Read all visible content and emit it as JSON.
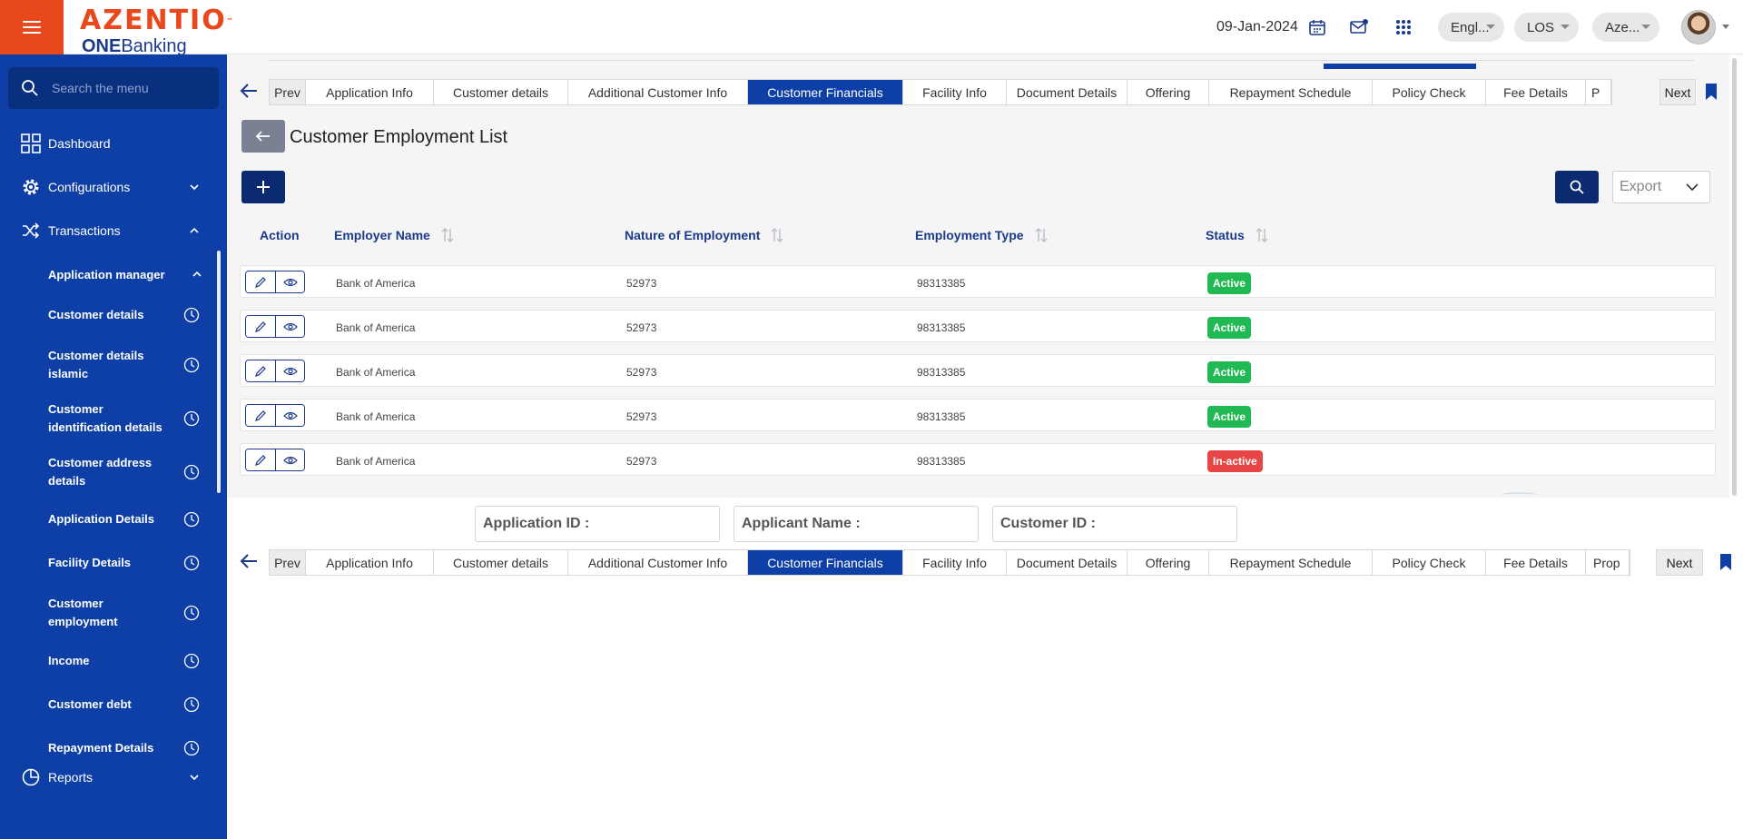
{
  "header": {
    "logo": "AZENTIO",
    "logo_tm": "™",
    "logo_sub_bold": "ONE",
    "logo_sub": "Banking",
    "date": "09-Jan-2024",
    "language": "Engl...",
    "module": "LOS",
    "entity": "Aze..."
  },
  "sidebar": {
    "search_placeholder": "Search the menu",
    "dashboard": "Dashboard",
    "configurations": "Configurations",
    "transactions": "Transactions",
    "application_manager": "Application manager",
    "sub_items": [
      "Customer details",
      "Customer details islamic",
      "Customer identification details",
      "Customer address details",
      "Application Details",
      "Facility Details",
      "Customer employment",
      "Income",
      "Customer debt",
      "Repayment Details"
    ],
    "reports": "Reports"
  },
  "tabs": {
    "prev": "Prev",
    "next": "Next",
    "items": [
      "Application Info",
      "Customer details",
      "Additional Customer Info",
      "Customer Financials",
      "Facility Info",
      "Document Details",
      "Offering",
      "Repayment Schedule",
      "Policy Check",
      "Fee Details",
      "Prop"
    ],
    "active": "Customer Financials",
    "top_truncated_last": "P"
  },
  "list": {
    "title": "Customer Employment List",
    "export_label": "Export",
    "columns": [
      "Action",
      "Employer Name",
      "Nature of Employment",
      "Employment Type",
      "Status"
    ],
    "rows": [
      {
        "employer": "Bank of America",
        "nature": "52973",
        "type": "98313385",
        "status": "Active"
      },
      {
        "employer": "Bank of America",
        "nature": "52973",
        "type": "98313385",
        "status": "Active"
      },
      {
        "employer": "Bank of America",
        "nature": "52973",
        "type": "98313385",
        "status": "Active"
      },
      {
        "employer": "Bank of America",
        "nature": "52973",
        "type": "98313385",
        "status": "Active"
      },
      {
        "employer": "Bank of America",
        "nature": "52973",
        "type": "98313385",
        "status": "In-active"
      }
    ]
  },
  "info": {
    "application_id": "Application ID :",
    "applicant_name": "Applicant Name :",
    "customer_id": "Customer ID :"
  },
  "colors": {
    "brand_orange": "#e8481b",
    "sidebar_blue": "#0d3fa6",
    "dark_navy": "#0b2a6f",
    "active_green": "#21b954",
    "inactive_red": "#e84545"
  }
}
